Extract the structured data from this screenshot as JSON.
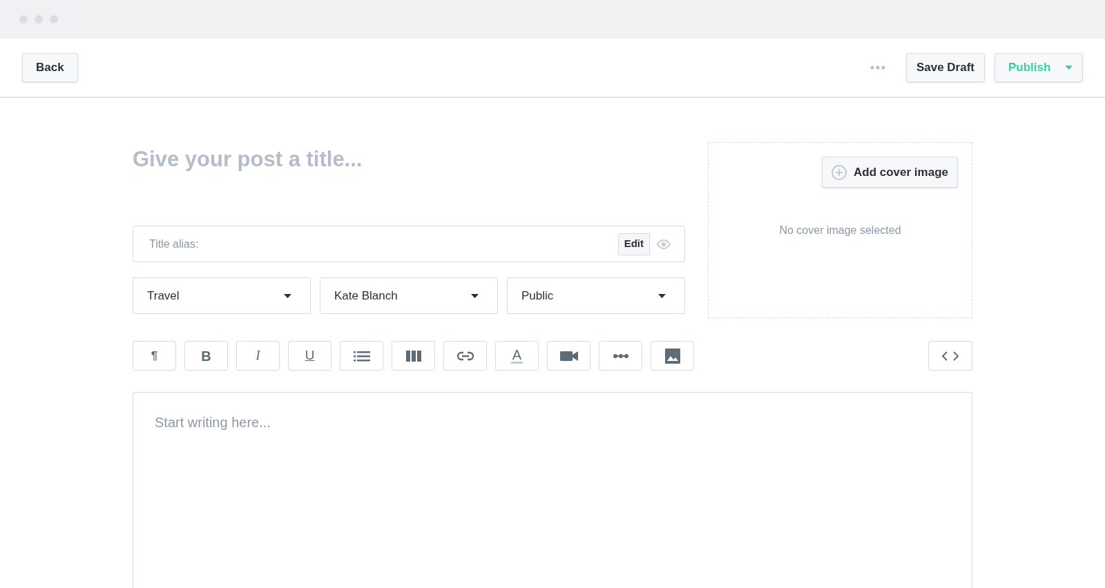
{
  "header": {
    "back": "Back",
    "save_draft": "Save Draft",
    "publish": "Publish"
  },
  "post": {
    "title_placeholder": "Give your post a title...",
    "alias_label": "Title alias:",
    "alias_edit": "Edit",
    "selects": [
      {
        "value": "Travel"
      },
      {
        "value": "Kate Blanch"
      },
      {
        "value": "Public"
      }
    ],
    "cover": {
      "button": "Add cover image",
      "status": "No cover image selected"
    },
    "toolbar": [
      {
        "kind": "paragraph",
        "label": "¶"
      },
      {
        "kind": "bold",
        "label": "B"
      },
      {
        "kind": "italic",
        "label": "I"
      },
      {
        "kind": "underline",
        "label": "U"
      },
      {
        "kind": "list"
      },
      {
        "kind": "columns"
      },
      {
        "kind": "link"
      },
      {
        "kind": "color",
        "label": "A"
      },
      {
        "kind": "video"
      },
      {
        "kind": "divider"
      },
      {
        "kind": "image"
      }
    ],
    "body_placeholder": "Start writing here..."
  }
}
